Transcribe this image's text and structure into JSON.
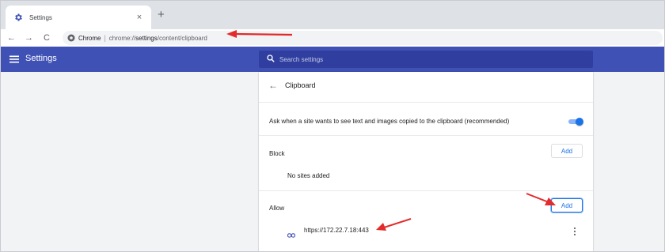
{
  "tab": {
    "title": "Settings",
    "close": "×",
    "new_tab": "+"
  },
  "toolbar": {
    "back": "←",
    "forward": "→",
    "reload": "C",
    "chip": "Chrome",
    "separator": "|",
    "url_prefix": "chrome://",
    "url_bold": "settings",
    "url_suffix": "/content/clipboard"
  },
  "header": {
    "title": "Settings",
    "search_placeholder": "Search settings"
  },
  "page": {
    "title": "Clipboard",
    "ask_label": "Ask when a site wants to see text and images copied to the clipboard (recommended)",
    "ask_enabled": true,
    "block": {
      "label": "Block",
      "add": "Add",
      "empty": "No sites added"
    },
    "allow": {
      "label": "Allow",
      "add": "Add",
      "sites": [
        {
          "url": "https://172.22.7.18:443"
        }
      ]
    }
  },
  "colors": {
    "header_bg": "#3f51b5",
    "search_bg": "#303f9f",
    "accent": "#1a73e8",
    "annotation": "#e32b2b"
  },
  "icons": [
    "settings-gear-icon",
    "hamburger-menu-icon",
    "search-icon",
    "back-arrow-icon",
    "chrome-chip-icon",
    "site-link-icon",
    "more-vert-icon",
    "red-arrow-annotation"
  ]
}
